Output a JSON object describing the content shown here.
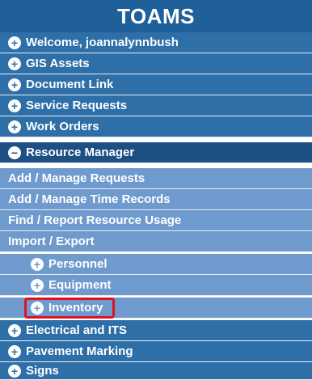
{
  "app": {
    "title": "TOAMS"
  },
  "menu": {
    "top_items": [
      {
        "label": "Welcome, joannalynnbush",
        "icon": "plus-circle-icon"
      },
      {
        "label": "GIS Assets",
        "icon": "plus-circle-icon"
      },
      {
        "label": "Document Link",
        "icon": "plus-circle-icon"
      },
      {
        "label": "Service Requests",
        "icon": "plus-circle-icon"
      },
      {
        "label": "Work Orders",
        "icon": "plus-circle-icon"
      }
    ],
    "resource_manager": {
      "label": "Resource Manager",
      "icon": "minus-circle-icon",
      "links": [
        "Add / Manage Requests",
        "Add / Manage Time Records",
        "Find / Report Resource Usage",
        "Import / Export"
      ],
      "subgroups": [
        {
          "label": "Personnel",
          "icon": "plus-circle-icon"
        },
        {
          "label": "Equipment",
          "icon": "plus-circle-icon"
        },
        {
          "label": "Inventory",
          "icon": "plus-circle-icon",
          "highlighted": true
        }
      ]
    },
    "bottom_items": [
      {
        "label": "Electrical and ITS",
        "icon": "plus-circle-icon"
      },
      {
        "label": "Pavement Marking",
        "icon": "plus-circle-icon"
      },
      {
        "label": "Signs",
        "icon": "plus-circle-icon"
      }
    ],
    "icon_glyphs": {
      "plus": "+",
      "minus": "−"
    }
  },
  "colors": {
    "header": "#1f5f9a",
    "top_item": "#2e6fa8",
    "open_item": "#1e4f82",
    "sub_item": "#6f9acd",
    "highlight_border": "#e31020"
  }
}
